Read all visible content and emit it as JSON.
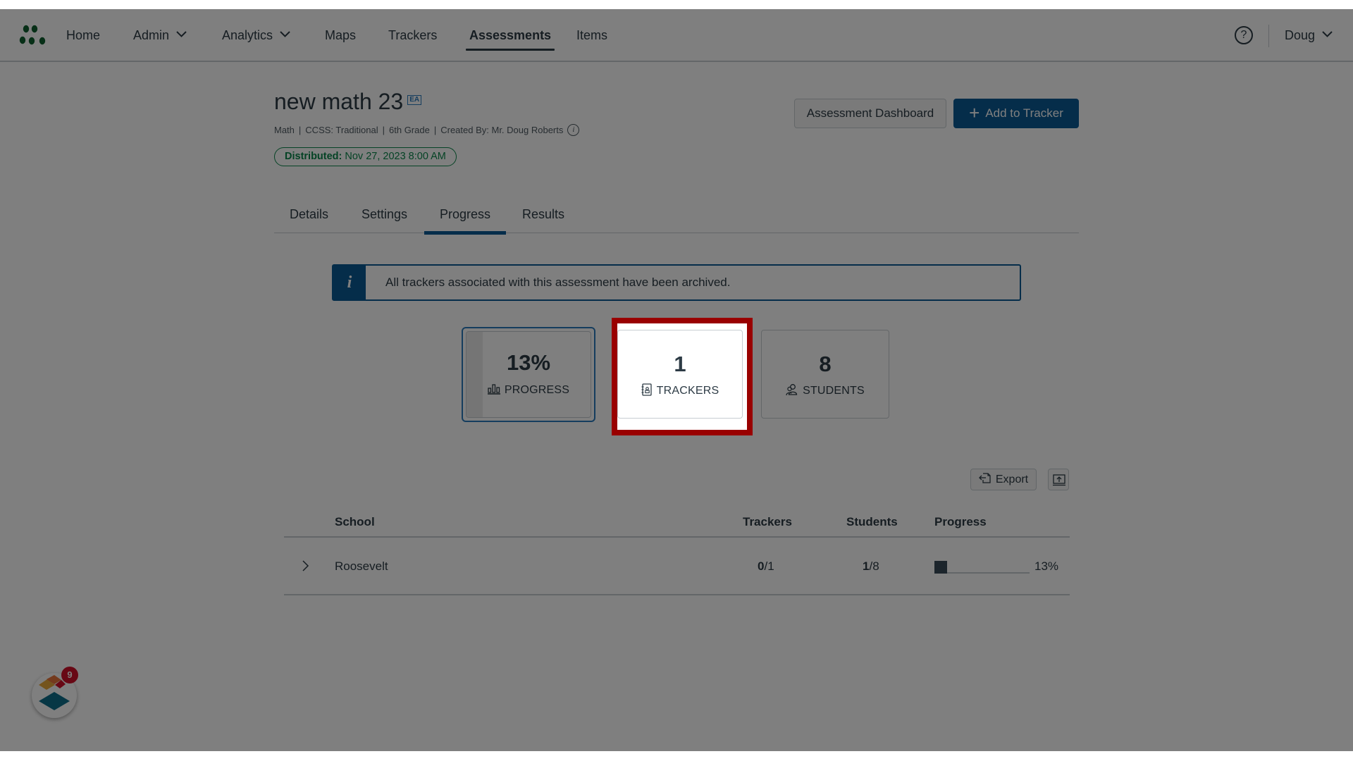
{
  "nav": {
    "items": [
      {
        "label": "Home",
        "dropdown": false,
        "active": false
      },
      {
        "label": "Admin",
        "dropdown": true,
        "active": false
      },
      {
        "label": "Analytics",
        "dropdown": true,
        "active": false
      },
      {
        "label": "Maps",
        "dropdown": false,
        "active": false
      },
      {
        "label": "Trackers",
        "dropdown": false,
        "active": false
      },
      {
        "label": "Assessments",
        "dropdown": false,
        "active": true
      },
      {
        "label": "Items",
        "dropdown": false,
        "active": false
      }
    ],
    "help_icon": "question-circle-icon",
    "user": "Doug"
  },
  "assessment": {
    "title": "new math 23",
    "badge": "EA",
    "meta": [
      "Math",
      "CCSS: Traditional",
      "6th Grade",
      "Created By: Mr. Doug Roberts"
    ],
    "distributed_label": "Distributed:",
    "distributed_value": "Nov 27, 2023 8:00 AM"
  },
  "actions": {
    "dashboard": "Assessment Dashboard",
    "add_to_tracker": "Add to Tracker"
  },
  "tabs": [
    {
      "label": "Details",
      "active": false
    },
    {
      "label": "Settings",
      "active": false
    },
    {
      "label": "Progress",
      "active": true
    },
    {
      "label": "Results",
      "active": false
    }
  ],
  "banner": {
    "icon": "info-icon",
    "text": "All trackers associated with this assessment have been archived."
  },
  "stats": {
    "progress": {
      "value": "13%",
      "label": "PROGRESS",
      "fill_fraction": 0.13,
      "selected": true
    },
    "trackers": {
      "value": "1",
      "label": "TRACKERS",
      "highlighted": true
    },
    "students": {
      "value": "8",
      "label": "STUDENTS"
    }
  },
  "toolbar": {
    "export": "Export"
  },
  "table": {
    "columns": [
      "School",
      "Trackers",
      "Students",
      "Progress"
    ],
    "rows": [
      {
        "school": "Roosevelt",
        "trackers_done": "0",
        "trackers_total": "/1",
        "students_done": "1",
        "students_total": "/8",
        "progress_fraction": 0.13,
        "progress_label": "13%"
      }
    ]
  },
  "chat_widget": {
    "badge_count": "9"
  },
  "colors": {
    "primary": "#0a5a95",
    "distributed": "#0b874b",
    "highlight_border": "#990000",
    "badge": "#d0112b"
  }
}
